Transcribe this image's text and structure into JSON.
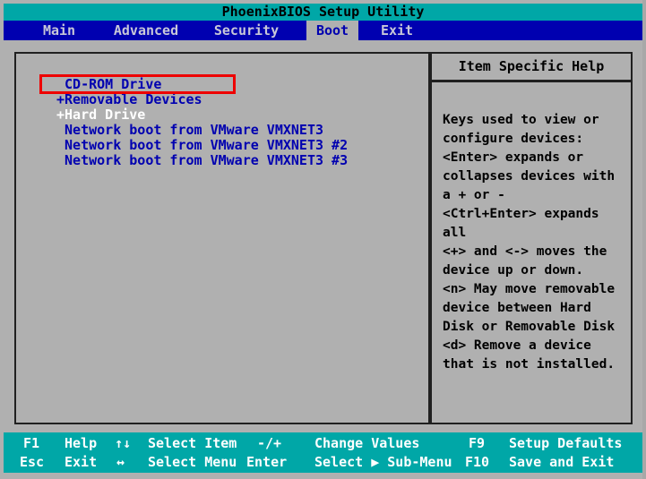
{
  "window": {
    "title": "PhoenixBIOS Setup Utility"
  },
  "menu": {
    "items": [
      {
        "label": "Main",
        "active": false
      },
      {
        "label": "Advanced",
        "active": false
      },
      {
        "label": "Security",
        "active": false
      },
      {
        "label": "Boot",
        "active": true
      },
      {
        "label": "Exit",
        "active": false
      }
    ]
  },
  "boot": {
    "devices": [
      {
        "prefix": " ",
        "label": "CD-ROM Drive",
        "style": "blue",
        "annotated": true
      },
      {
        "prefix": "+",
        "label": "Removable Devices",
        "style": "blue",
        "annotated": false
      },
      {
        "prefix": "+",
        "label": "Hard Drive",
        "style": "white",
        "annotated": false
      },
      {
        "prefix": " ",
        "label": "Network boot from VMware VMXNET3",
        "style": "blue",
        "annotated": false
      },
      {
        "prefix": " ",
        "label": "Network boot from VMware VMXNET3 #2",
        "style": "blue",
        "annotated": false
      },
      {
        "prefix": " ",
        "label": "Network boot from VMware VMXNET3 #3",
        "style": "blue",
        "annotated": false
      }
    ]
  },
  "help": {
    "header": "Item Specific Help",
    "body": "Keys used to view or\nconfigure devices:\n<Enter> expands or\ncollapses devices with\na + or -\n<Ctrl+Enter> expands\nall\n<+> and <-> moves the\ndevice up or down.\n<n> May move removable\ndevice between Hard\nDisk or Removable Disk\n<d> Remove a device\nthat is not installed."
  },
  "keybar": {
    "row1": [
      {
        "key": "F1",
        "action": "Help"
      },
      {
        "key": "↑↓",
        "action": "Select Item"
      },
      {
        "key": "-/+",
        "action": "Change Values"
      },
      {
        "key": "F9",
        "action": "Setup Defaults"
      }
    ],
    "row2": [
      {
        "key": "Esc",
        "action": "Exit"
      },
      {
        "key": "↔",
        "action": "Select Menu"
      },
      {
        "key": "Enter",
        "action": "Select ▶ Sub-Menu"
      },
      {
        "key": "F10",
        "action": "Save and Exit"
      }
    ]
  },
  "colors": {
    "title_bar": "#00a7a7",
    "menu_bar": "#0000b0",
    "panel_bg": "#b0b0b0",
    "text_blue": "#0000b0",
    "text_white": "#ffffff",
    "annotation": "#ee0000"
  }
}
